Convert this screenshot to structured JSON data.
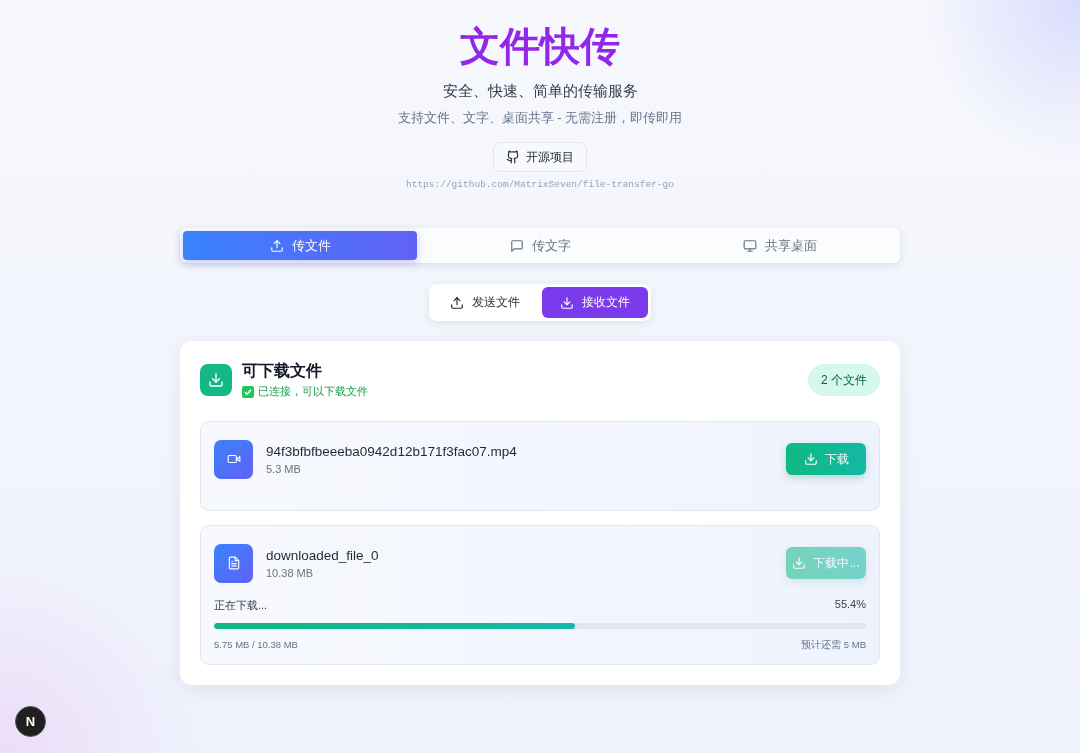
{
  "header": {
    "title": "文件快传",
    "subtitle": "安全、快速、简单的传输服务",
    "tagline": "支持文件、文字、桌面共享 - 无需注册，即传即用",
    "repo_button": "开源项目",
    "repo_url": "https://github.com/MatrixSeven/file-transfer-go"
  },
  "tabs": [
    {
      "kind": "upload",
      "label": "传文件",
      "selected": true
    },
    {
      "kind": "message",
      "label": "传文字",
      "selected": false
    },
    {
      "kind": "monitor",
      "label": "共享桌面",
      "selected": false
    }
  ],
  "mode_toggle": [
    {
      "kind": "upload",
      "label": "发送文件",
      "selected": false
    },
    {
      "kind": "download",
      "label": "接收文件",
      "selected": true
    }
  ],
  "panel": {
    "title": "可下载文件",
    "status": "已连接，可以下载文件",
    "connected": true,
    "count": "2 个文件"
  },
  "files": [
    {
      "kind": "video",
      "name": "94f3bfbfbeeeba0942d12b171f3fac07.mp4",
      "size": "5.3 MB",
      "button": "下载",
      "downloading": false
    },
    {
      "kind": "document",
      "name": "downloaded_file_0",
      "size": "10.38 MB",
      "button": "下载中...",
      "downloading": true,
      "progress_label": "正在下载...",
      "percent": "55.4%",
      "level": 0.554,
      "transferred": "5.75 MB / 10.38 MB",
      "remaining": "预计还需 5 MB"
    }
  ],
  "dev_badge": {
    "label": "N"
  }
}
